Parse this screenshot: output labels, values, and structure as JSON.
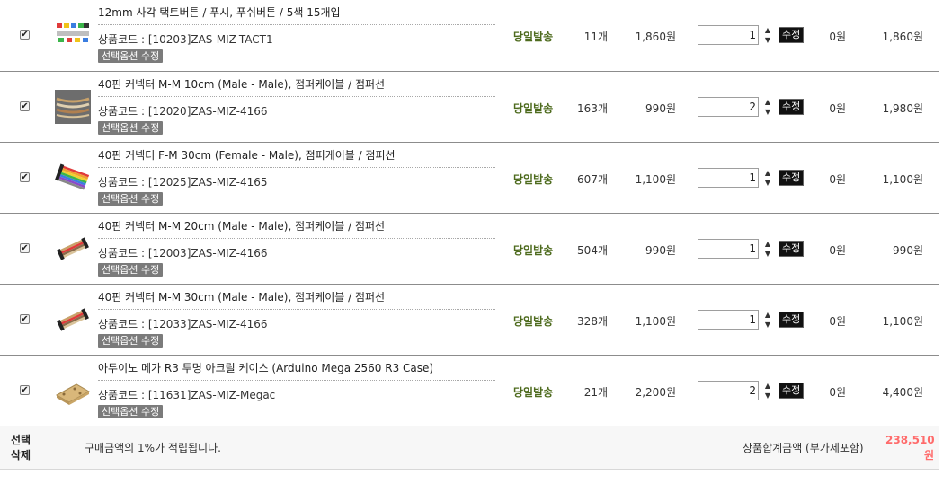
{
  "rows": [
    {
      "name": "12mm 사각 택트버튼 / 푸시, 푸쉬버튼 / 5색 15개입",
      "code": "상품코드 : [10203]ZAS-MIZ-TACT1",
      "option_button": "선택옵션 수정",
      "shipping": "당일발송",
      "stock": "11개",
      "price": "1,860원",
      "qty": "1",
      "modify_button": "수정",
      "discount": "0원",
      "total": "1,860원",
      "thumb": "tact-button-icon",
      "checked": true
    },
    {
      "name": "40핀 커넥터 M-M 10cm (Male - Male), 점퍼케이블 / 점퍼선",
      "code": "상품코드 : [12020]ZAS-MIZ-4166",
      "option_button": "선택옵션 수정",
      "shipping": "당일발송",
      "stock": "163개",
      "price": "990원",
      "qty": "2",
      "modify_button": "수정",
      "discount": "0원",
      "total": "1,980원",
      "thumb": "jumper-cable-icon",
      "checked": true
    },
    {
      "name": "40핀 커넥터 F-M 30cm (Female - Male), 점퍼케이블 / 점퍼선",
      "code": "상품코드 : [12025]ZAS-MIZ-4165",
      "option_button": "선택옵션 수정",
      "shipping": "당일발송",
      "stock": "607개",
      "price": "1,100원",
      "qty": "1",
      "modify_button": "수정",
      "discount": "0원",
      "total": "1,100원",
      "thumb": "ribbon-cable-icon",
      "checked": true
    },
    {
      "name": "40핀 커넥터 M-M 20cm (Male - Male), 점퍼케이블 / 점퍼선",
      "code": "상품코드 : [12003]ZAS-MIZ-4166",
      "option_button": "선택옵션 수정",
      "shipping": "당일발송",
      "stock": "504개",
      "price": "990원",
      "qty": "1",
      "modify_button": "수정",
      "discount": "0원",
      "total": "990원",
      "thumb": "jumper-cable-icon",
      "checked": true
    },
    {
      "name": "40핀 커넥터 M-M 30cm (Male - Male), 점퍼케이블 / 점퍼선",
      "code": "상품코드 : [12033]ZAS-MIZ-4166",
      "option_button": "선택옵션 수정",
      "shipping": "당일발송",
      "stock": "328개",
      "price": "1,100원",
      "qty": "1",
      "modify_button": "수정",
      "discount": "0원",
      "total": "1,100원",
      "thumb": "jumper-cable-icon",
      "checked": true
    },
    {
      "name": "아두이노 메가 R3 투명 아크릴 케이스 (Arduino Mega 2560 R3 Case)",
      "code": "상품코드 : [11631]ZAS-MIZ-Megac",
      "option_button": "선택옵션 수정",
      "shipping": "당일발송",
      "stock": "21개",
      "price": "2,200원",
      "qty": "2",
      "modify_button": "수정",
      "discount": "0원",
      "total": "4,400원",
      "thumb": "acrylic-case-icon",
      "checked": true
    }
  ],
  "footer": {
    "delete_line1": "선택",
    "delete_line2": "삭제",
    "point_text": "구매금액의 1%가 적립됩니다.",
    "sum_label": "상품합계금액 (부가세포함)",
    "sum_value_line1": "238,510",
    "sum_value_line2": "원"
  },
  "colors": {
    "shipping": "#4e6b1e",
    "sum_value": "#ff6b6b",
    "option_button_bg": "#7b7b7b",
    "modify_button_bg": "#111111"
  }
}
